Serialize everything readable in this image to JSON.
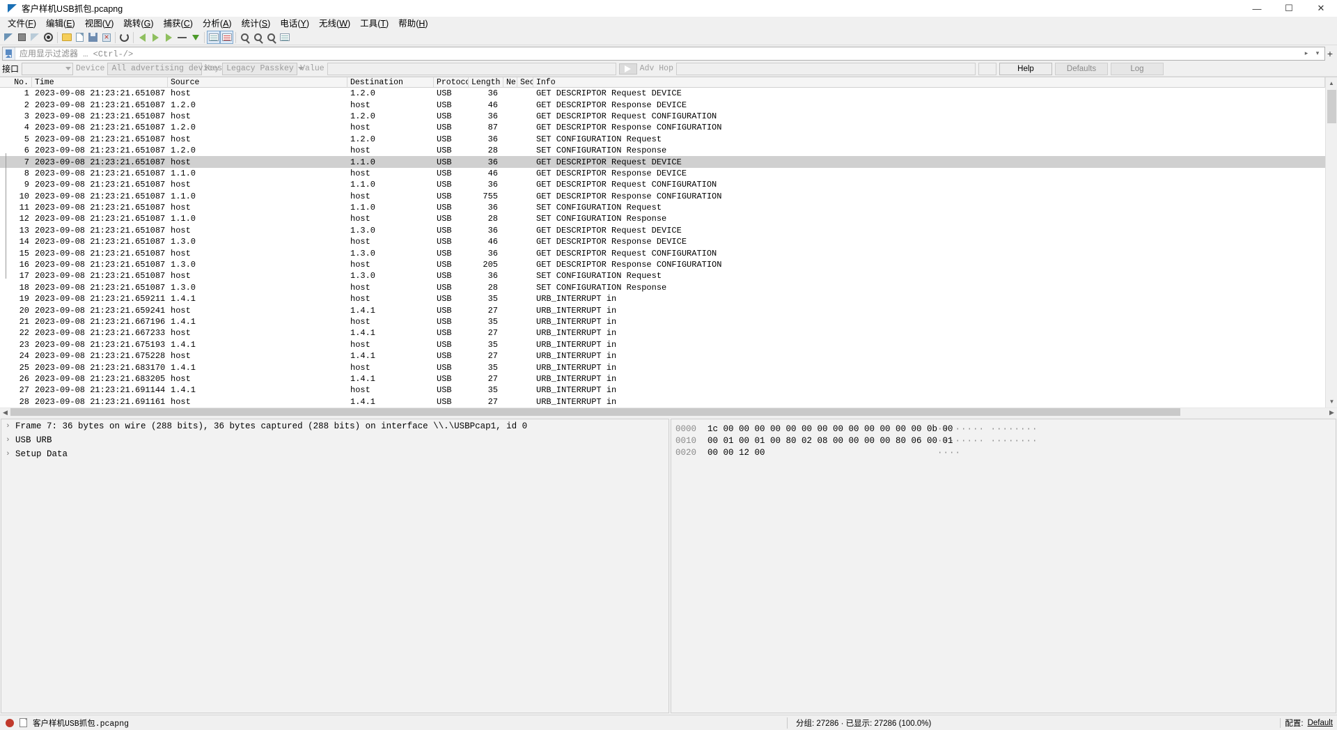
{
  "window": {
    "title": "客户样机USB抓包.pcapng",
    "icon": "wireshark-fin-icon",
    "minimize": "—",
    "maximize": "☐",
    "close": "✕"
  },
  "menu": [
    {
      "label": "文件",
      "accel": "F"
    },
    {
      "label": "编辑",
      "accel": "E"
    },
    {
      "label": "视图",
      "accel": "V"
    },
    {
      "label": "跳转",
      "accel": "G"
    },
    {
      "label": "捕获",
      "accel": "C"
    },
    {
      "label": "分析",
      "accel": "A"
    },
    {
      "label": "统计",
      "accel": "S"
    },
    {
      "label": "电话",
      "accel": "Y"
    },
    {
      "label": "无线",
      "accel": "W"
    },
    {
      "label": "工具",
      "accel": "T"
    },
    {
      "label": "帮助",
      "accel": "H"
    }
  ],
  "toolbar": [
    {
      "name": "start-capture-icon"
    },
    {
      "name": "stop-capture-icon"
    },
    {
      "name": "restart-capture-icon"
    },
    {
      "name": "capture-options-icon"
    },
    {
      "name": "open-file-icon"
    },
    {
      "name": "save-as-icon"
    },
    {
      "name": "close-file-icon"
    },
    {
      "name": "reload-file-icon"
    },
    {
      "name": "find-packet-icon"
    },
    {
      "name": "go-back-icon"
    },
    {
      "name": "go-forward-icon"
    },
    {
      "name": "go-to-packet-icon"
    },
    {
      "name": "go-to-first-icon"
    },
    {
      "name": "go-to-last-icon"
    },
    {
      "name": "auto-scroll-icon"
    },
    {
      "name": "colorize-icon"
    },
    {
      "name": "zoom-in-icon"
    },
    {
      "name": "zoom-out-icon"
    },
    {
      "name": "zoom-reset-icon"
    },
    {
      "name": "resize-columns-icon"
    }
  ],
  "display_filter": {
    "placeholder": "应用显示过滤器 … <Ctrl-/>",
    "value": "",
    "bookmark_icon": "bookmark-icon",
    "clear_icon": "clear-filter-icon",
    "apply_icon": "apply-filter-icon",
    "add_icon": "add-filter-button-icon"
  },
  "bluetooth_toolbar": {
    "interface_label": "接口",
    "interface_value": "",
    "device_label": "Device",
    "device_value": "All advertising devices",
    "key_label": "Key",
    "key_value": "Legacy Passkey",
    "value_label": "Value",
    "value_value": "",
    "go_icon": "go-arrow-icon",
    "adv_hop_label": "Adv Hop",
    "adv_hop_value": "",
    "help_label": "Help",
    "defaults_label": "Defaults",
    "log_label": "Log"
  },
  "packet_list": {
    "columns": [
      {
        "key": "no",
        "label": "No."
      },
      {
        "key": "time",
        "label": "Time"
      },
      {
        "key": "source",
        "label": "Source"
      },
      {
        "key": "destination",
        "label": "Destination"
      },
      {
        "key": "protocol",
        "label": "Protocol"
      },
      {
        "key": "length",
        "label": "Length"
      },
      {
        "key": "ne",
        "label": "Ne"
      },
      {
        "key": "sec",
        "label": "Sec"
      },
      {
        "key": "info",
        "label": "Info"
      }
    ],
    "selected_row": 7,
    "rows": [
      {
        "no": "1",
        "time": "2023-09-08 21:23:21.651087",
        "source": "host",
        "destination": "1.2.0",
        "protocol": "USB",
        "length": "36",
        "ne": "",
        "sec": "",
        "info": "GET DESCRIPTOR Request DEVICE"
      },
      {
        "no": "2",
        "time": "2023-09-08 21:23:21.651087",
        "source": "1.2.0",
        "destination": "host",
        "protocol": "USB",
        "length": "46",
        "ne": "",
        "sec": "",
        "info": "GET DESCRIPTOR Response DEVICE"
      },
      {
        "no": "3",
        "time": "2023-09-08 21:23:21.651087",
        "source": "host",
        "destination": "1.2.0",
        "protocol": "USB",
        "length": "36",
        "ne": "",
        "sec": "",
        "info": "GET DESCRIPTOR Request CONFIGURATION"
      },
      {
        "no": "4",
        "time": "2023-09-08 21:23:21.651087",
        "source": "1.2.0",
        "destination": "host",
        "protocol": "USB",
        "length": "87",
        "ne": "",
        "sec": "",
        "info": "GET DESCRIPTOR Response CONFIGURATION"
      },
      {
        "no": "5",
        "time": "2023-09-08 21:23:21.651087",
        "source": "host",
        "destination": "1.2.0",
        "protocol": "USB",
        "length": "36",
        "ne": "",
        "sec": "",
        "info": "SET CONFIGURATION Request"
      },
      {
        "no": "6",
        "time": "2023-09-08 21:23:21.651087",
        "source": "1.2.0",
        "destination": "host",
        "protocol": "USB",
        "length": "28",
        "ne": "",
        "sec": "",
        "info": "SET CONFIGURATION Response"
      },
      {
        "no": "7",
        "time": "2023-09-08 21:23:21.651087",
        "source": "host",
        "destination": "1.1.0",
        "protocol": "USB",
        "length": "36",
        "ne": "",
        "sec": "",
        "info": "GET DESCRIPTOR Request DEVICE"
      },
      {
        "no": "8",
        "time": "2023-09-08 21:23:21.651087",
        "source": "1.1.0",
        "destination": "host",
        "protocol": "USB",
        "length": "46",
        "ne": "",
        "sec": "",
        "info": "GET DESCRIPTOR Response DEVICE"
      },
      {
        "no": "9",
        "time": "2023-09-08 21:23:21.651087",
        "source": "host",
        "destination": "1.1.0",
        "protocol": "USB",
        "length": "36",
        "ne": "",
        "sec": "",
        "info": "GET DESCRIPTOR Request CONFIGURATION"
      },
      {
        "no": "10",
        "time": "2023-09-08 21:23:21.651087",
        "source": "1.1.0",
        "destination": "host",
        "protocol": "USB",
        "length": "755",
        "ne": "",
        "sec": "",
        "info": "GET DESCRIPTOR Response CONFIGURATION"
      },
      {
        "no": "11",
        "time": "2023-09-08 21:23:21.651087",
        "source": "host",
        "destination": "1.1.0",
        "protocol": "USB",
        "length": "36",
        "ne": "",
        "sec": "",
        "info": "SET CONFIGURATION Request"
      },
      {
        "no": "12",
        "time": "2023-09-08 21:23:21.651087",
        "source": "1.1.0",
        "destination": "host",
        "protocol": "USB",
        "length": "28",
        "ne": "",
        "sec": "",
        "info": "SET CONFIGURATION Response"
      },
      {
        "no": "13",
        "time": "2023-09-08 21:23:21.651087",
        "source": "host",
        "destination": "1.3.0",
        "protocol": "USB",
        "length": "36",
        "ne": "",
        "sec": "",
        "info": "GET DESCRIPTOR Request DEVICE"
      },
      {
        "no": "14",
        "time": "2023-09-08 21:23:21.651087",
        "source": "1.3.0",
        "destination": "host",
        "protocol": "USB",
        "length": "46",
        "ne": "",
        "sec": "",
        "info": "GET DESCRIPTOR Response DEVICE"
      },
      {
        "no": "15",
        "time": "2023-09-08 21:23:21.651087",
        "source": "host",
        "destination": "1.3.0",
        "protocol": "USB",
        "length": "36",
        "ne": "",
        "sec": "",
        "info": "GET DESCRIPTOR Request CONFIGURATION"
      },
      {
        "no": "16",
        "time": "2023-09-08 21:23:21.651087",
        "source": "1.3.0",
        "destination": "host",
        "protocol": "USB",
        "length": "205",
        "ne": "",
        "sec": "",
        "info": "GET DESCRIPTOR Response CONFIGURATION"
      },
      {
        "no": "17",
        "time": "2023-09-08 21:23:21.651087",
        "source": "host",
        "destination": "1.3.0",
        "protocol": "USB",
        "length": "36",
        "ne": "",
        "sec": "",
        "info": "SET CONFIGURATION Request"
      },
      {
        "no": "18",
        "time": "2023-09-08 21:23:21.651087",
        "source": "1.3.0",
        "destination": "host",
        "protocol": "USB",
        "length": "28",
        "ne": "",
        "sec": "",
        "info": "SET CONFIGURATION Response"
      },
      {
        "no": "19",
        "time": "2023-09-08 21:23:21.659211",
        "source": "1.4.1",
        "destination": "host",
        "protocol": "USB",
        "length": "35",
        "ne": "",
        "sec": "",
        "info": "URB_INTERRUPT in"
      },
      {
        "no": "20",
        "time": "2023-09-08 21:23:21.659241",
        "source": "host",
        "destination": "1.4.1",
        "protocol": "USB",
        "length": "27",
        "ne": "",
        "sec": "",
        "info": "URB_INTERRUPT in"
      },
      {
        "no": "21",
        "time": "2023-09-08 21:23:21.667196",
        "source": "1.4.1",
        "destination": "host",
        "protocol": "USB",
        "length": "35",
        "ne": "",
        "sec": "",
        "info": "URB_INTERRUPT in"
      },
      {
        "no": "22",
        "time": "2023-09-08 21:23:21.667233",
        "source": "host",
        "destination": "1.4.1",
        "protocol": "USB",
        "length": "27",
        "ne": "",
        "sec": "",
        "info": "URB_INTERRUPT in"
      },
      {
        "no": "23",
        "time": "2023-09-08 21:23:21.675193",
        "source": "1.4.1",
        "destination": "host",
        "protocol": "USB",
        "length": "35",
        "ne": "",
        "sec": "",
        "info": "URB_INTERRUPT in"
      },
      {
        "no": "24",
        "time": "2023-09-08 21:23:21.675228",
        "source": "host",
        "destination": "1.4.1",
        "protocol": "USB",
        "length": "27",
        "ne": "",
        "sec": "",
        "info": "URB_INTERRUPT in"
      },
      {
        "no": "25",
        "time": "2023-09-08 21:23:21.683170",
        "source": "1.4.1",
        "destination": "host",
        "protocol": "USB",
        "length": "35",
        "ne": "",
        "sec": "",
        "info": "URB_INTERRUPT in"
      },
      {
        "no": "26",
        "time": "2023-09-08 21:23:21.683205",
        "source": "host",
        "destination": "1.4.1",
        "protocol": "USB",
        "length": "27",
        "ne": "",
        "sec": "",
        "info": "URB_INTERRUPT in"
      },
      {
        "no": "27",
        "time": "2023-09-08 21:23:21.691144",
        "source": "1.4.1",
        "destination": "host",
        "protocol": "USB",
        "length": "35",
        "ne": "",
        "sec": "",
        "info": "URB_INTERRUPT in"
      },
      {
        "no": "28",
        "time": "2023-09-08 21:23:21.691161",
        "source": "host",
        "destination": "1.4.1",
        "protocol": "USB",
        "length": "27",
        "ne": "",
        "sec": "",
        "info": "URB_INTERRUPT in"
      }
    ]
  },
  "packet_details": {
    "rows": [
      {
        "expander": "›",
        "text": "Frame 7: 36 bytes on wire (288 bits), 36 bytes captured (288 bits) on interface \\\\.\\USBPcap1, id 0"
      },
      {
        "expander": "›",
        "text": "USB URB"
      },
      {
        "expander": "›",
        "text": "Setup Data"
      }
    ]
  },
  "packet_bytes": {
    "rows": [
      {
        "offset": "0000",
        "bytes": "1c 00 00 00 00 00 00 00   00 00 00 00 00 00 0b 00",
        "ascii": "········ ········"
      },
      {
        "offset": "0010",
        "bytes": "00 01 00 01 00 80 02 08   00 00 00 00 80 06 00 01",
        "ascii": "········ ········"
      },
      {
        "offset": "0020",
        "bytes": "00 00 12 00",
        "ascii": "····"
      }
    ]
  },
  "status_bar": {
    "capture_icon": "capture-status-icon",
    "file_icon": "file-properties-icon",
    "file_name": "客户样机USB抓包.pcapng",
    "packets_text": "分组: 27286 · 已显示: 27286 (100.0%)",
    "profile_label": "配置:",
    "profile_value": "Default"
  },
  "colors": {
    "selected_row_bg": "#d0d0d0",
    "pane_bg": "#f2f2f2",
    "toolbar_bg": "#f0f0f0",
    "accent": "#1a6fb5"
  }
}
